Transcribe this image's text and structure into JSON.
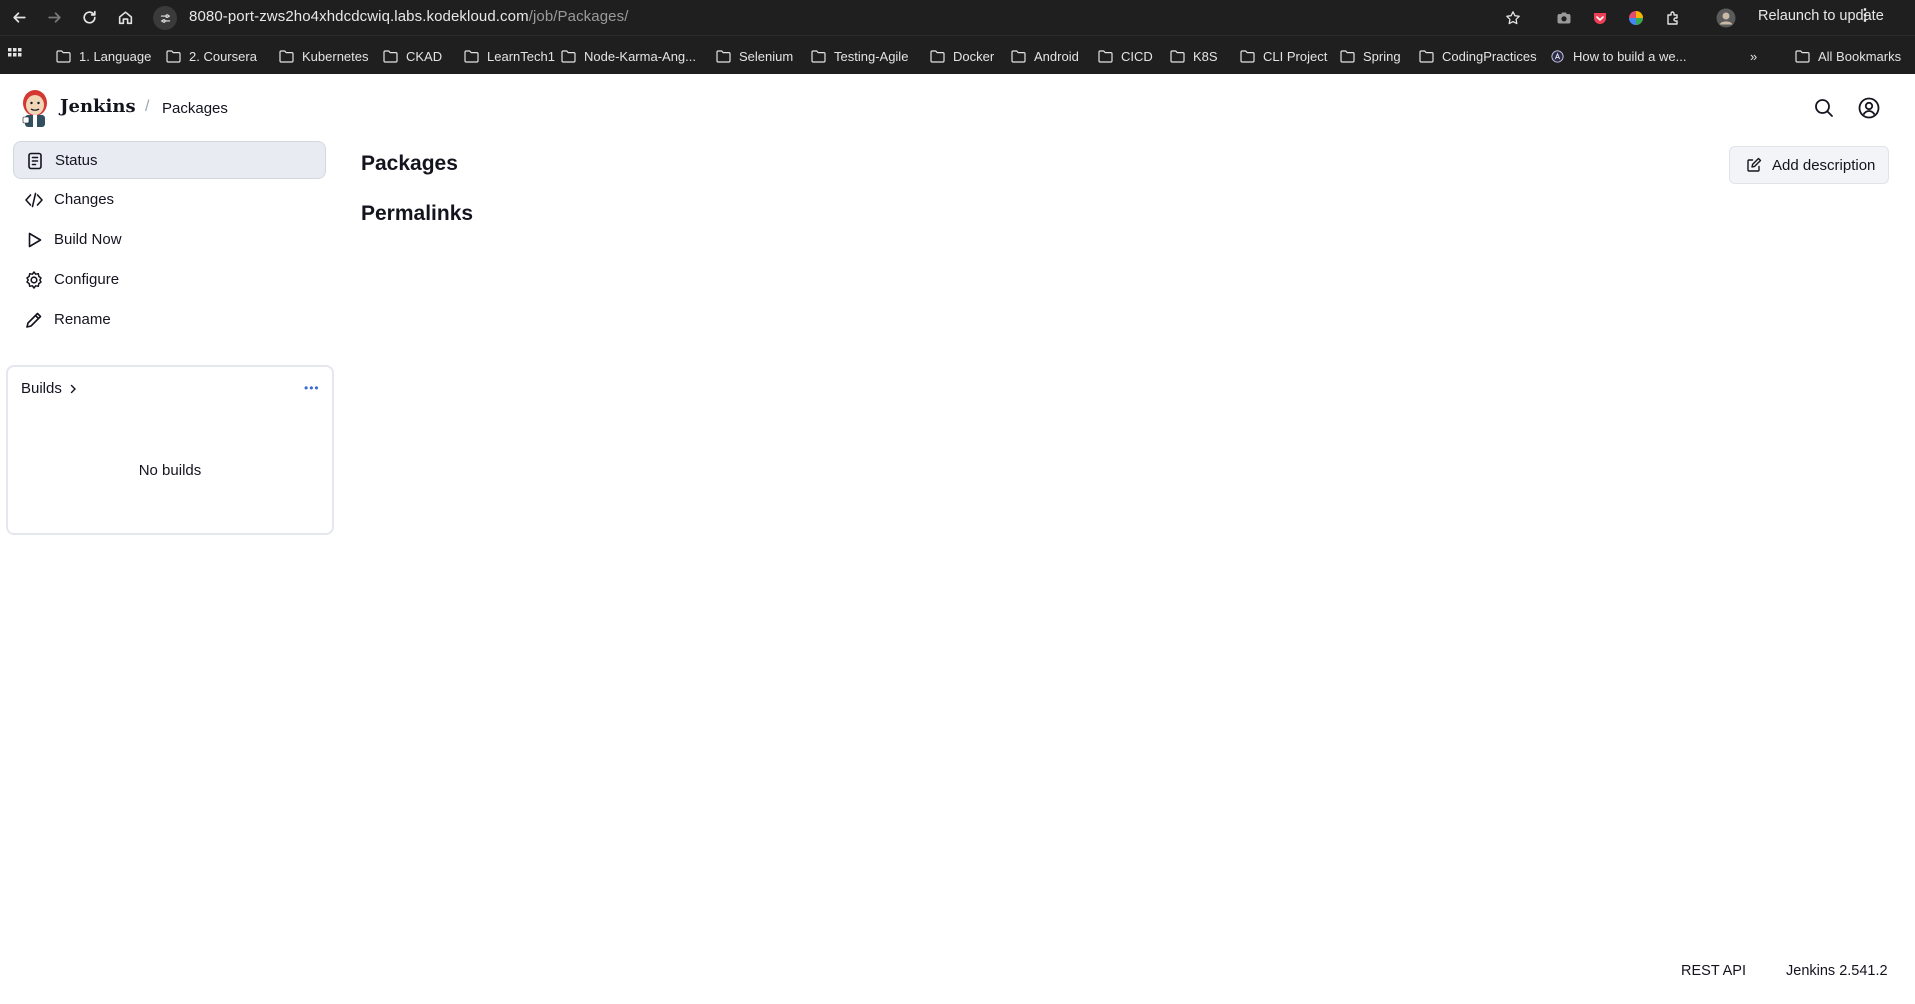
{
  "browser": {
    "url_host": "8080-port-zws2ho4xhdcdcwiq.labs.kodekloud.com",
    "url_path": "/job/Packages/",
    "relaunch_label": "Relaunch to update",
    "bookmarks": [
      "1. Language",
      "2. Coursera",
      "Kubernetes",
      "CKAD",
      "LearnTech1",
      "Node-Karma-Ang...",
      "Selenium",
      "Testing-Agile",
      "Docker",
      "Android",
      "CICD",
      "K8S",
      "CLI Project",
      "Spring",
      "CodingPractices",
      "How to build a we..."
    ],
    "all_bookmarks": "All Bookmarks",
    "overflow": "»"
  },
  "header": {
    "app_name": "Jenkins",
    "separator": "/",
    "breadcrumb": "Packages"
  },
  "sidebar": {
    "items": [
      {
        "label": "Status",
        "icon": "document-icon"
      },
      {
        "label": "Changes",
        "icon": "code-icon"
      },
      {
        "label": "Build Now",
        "icon": "play-icon"
      },
      {
        "label": "Configure",
        "icon": "gear-icon"
      },
      {
        "label": "Rename",
        "icon": "pencil-icon"
      }
    ]
  },
  "builds": {
    "title": "Builds",
    "more": "•••",
    "empty": "No builds"
  },
  "main": {
    "title": "Packages",
    "permalinks": "Permalinks",
    "add_description": "Add description"
  },
  "footer": {
    "rest_api": "REST API",
    "version": "Jenkins 2.541.2"
  }
}
